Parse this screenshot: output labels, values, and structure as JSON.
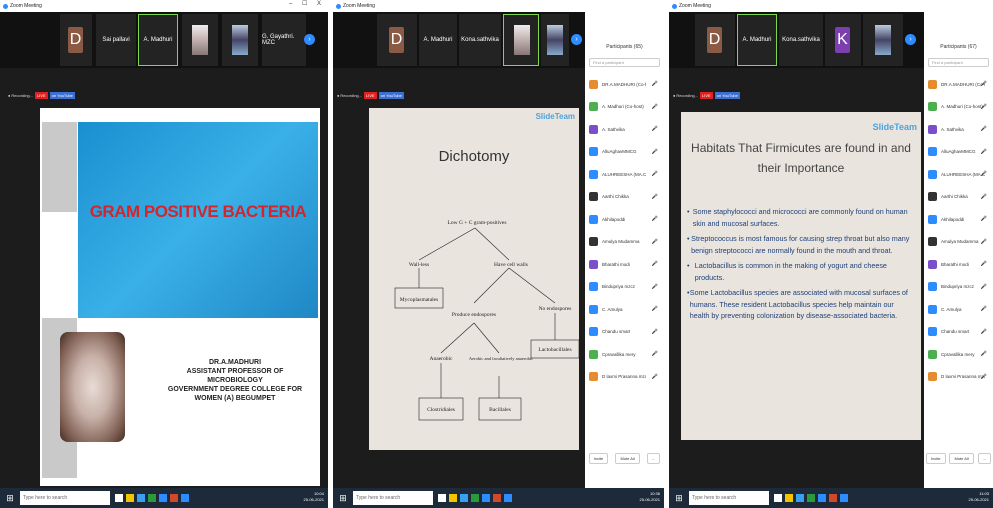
{
  "panel1": {
    "window_title": "Zoom Meeting",
    "window_controls": "– ☐ X",
    "tiles": [
      {
        "kind": "letter",
        "letter": "D",
        "name": "",
        "color": "#8a5a44"
      },
      {
        "kind": "name",
        "name": "Sai pallavi"
      },
      {
        "kind": "name",
        "name": "A. Madhuri"
      },
      {
        "kind": "photo",
        "name": ""
      },
      {
        "kind": "photo",
        "name": ""
      },
      {
        "kind": "name",
        "name": "G. Gayathri. MZC"
      }
    ],
    "recording": "Recording...",
    "live_label": "LIVE",
    "youtube_label": "on YouTube",
    "slide": {
      "title": "GRAM POSITIVE BACTERIA",
      "author_lines": [
        "DR.A.MADHURI",
        "ASSISTANT PROFESSOR OF MICROBIOLOGY",
        "GOVERNMENT DEGREE COLLEGE FOR",
        "WOMEN (A) BEGUMPET"
      ]
    },
    "search_placeholder": "Type here to search",
    "tray_time": "10:04",
    "tray_date": "25-06-2021"
  },
  "panel2": {
    "window_title": "Zoom Meeting",
    "tiles": [
      {
        "kind": "letter",
        "letter": "D",
        "name": "",
        "color": "#8a5a44"
      },
      {
        "kind": "name",
        "name": "A. Madhuri"
      },
      {
        "kind": "name",
        "name": "Kona.sathvika"
      },
      {
        "kind": "photo",
        "name": ""
      },
      {
        "kind": "photo",
        "name": ""
      }
    ],
    "recording": "Recording...",
    "live_label": "LIVE",
    "youtube_label": "on YouTube",
    "slide": {
      "watermark": "SlideTeam",
      "title": "Dichotomy",
      "root": "Low G + C gram-positives",
      "wall_less": "Wall-less",
      "have_walls": "Have cell walls",
      "myco": "Mycoplasmatales",
      "produce": "Produce endospores",
      "no_endo": "No endospores",
      "anaerobic": "Anaerobic",
      "aerobic": "Aerobic and facultatively anaerobic",
      "lacto": "Lactobacillales",
      "clostridiales": "Clostridiales",
      "bacillales": "Bacillales"
    },
    "participants_title": "Participants (65)",
    "participants_search": "Find a participant",
    "participants": [
      {
        "name": "DR.A.MADHURI (Co-host)",
        "color": "#e58c2e"
      },
      {
        "name": "A. Madhuri (Co-host)",
        "color": "#4caf50"
      },
      {
        "name": "A. Sathvika",
        "color": "#7b4fc9"
      },
      {
        "name": "AlluAghavMMCG",
        "color": "#2d8cff"
      },
      {
        "name": "ALUHREESHA (MA.Com)",
        "color": "#2d8cff"
      },
      {
        "name": "Aarthi Chikka",
        "color": "#333"
      },
      {
        "name": "Akhilapoddi",
        "color": "#2d8cff"
      },
      {
        "name": "Amulya Mudamma",
        "color": "#333"
      },
      {
        "name": "Bharathi modi",
        "color": "#7b4fc9"
      },
      {
        "name": "Bindupriya mzcz",
        "color": "#2d8cff"
      },
      {
        "name": "C. Amulya",
        "color": "#2d8cff"
      },
      {
        "name": "Chandu smart",
        "color": "#2d8cff"
      },
      {
        "name": "Cpravallika mery",
        "color": "#4caf50"
      },
      {
        "name": "D laxmi Prasanna mzc",
        "color": "#e58c2e"
      }
    ],
    "invite": "Invite",
    "mute_all": "Mute All",
    "more": "...",
    "search_placeholder": "Type here to search",
    "tray_time": "10:36",
    "tray_date": "25-06-2021"
  },
  "panel3": {
    "window_title": "Zoom Meeting",
    "tiles": [
      {
        "kind": "letter",
        "letter": "D",
        "name": "",
        "color": "#8a5a44"
      },
      {
        "kind": "name",
        "name": "A. Madhuri"
      },
      {
        "kind": "name",
        "name": "Kona.sathvika"
      },
      {
        "kind": "letter",
        "letter": "K",
        "name": "",
        "color": "#7b3fb0"
      },
      {
        "kind": "photo",
        "name": ""
      }
    ],
    "recording": "Recording...",
    "live_label": "LIVE",
    "youtube_label": "on YouTube",
    "slide": {
      "watermark": "SlideTeam",
      "title_line1": "Habitats That Firmicutes are found in and",
      "title_line2": "their Importance",
      "bullets": [
        "Some staphylococci and micrococci are commonly found on human skin and mucosal surfaces.",
        "Streptococcus is most famous for causing strep throat but also many benign streptococci are normally found in the mouth and throat.",
        "Lactobacillus is common in the making of yogurt and cheese products.",
        "Some Lactobacillus species are associated with mucosal surfaces of humans. These resident Lactobacillus species help maintain our health by preventing colonization by disease-associated bacteria."
      ]
    },
    "participants_title": "Participants (67)",
    "participants_search": "Find a participant",
    "participants": [
      {
        "name": "DR.A.MADHURI (Co-host)",
        "color": "#e58c2e"
      },
      {
        "name": "A. Madhuri (Co-host)",
        "color": "#4caf50"
      },
      {
        "name": "A. Sathvika",
        "color": "#7b4fc9"
      },
      {
        "name": "AlluAghavMMCG",
        "color": "#2d8cff"
      },
      {
        "name": "ALUHREESHA (MA.Com)",
        "color": "#2d8cff"
      },
      {
        "name": "Aarthi Chikka",
        "color": "#333"
      },
      {
        "name": "Akhilapoddi",
        "color": "#2d8cff"
      },
      {
        "name": "Amulya Mudamma",
        "color": "#333"
      },
      {
        "name": "Bharathi modi",
        "color": "#7b4fc9"
      },
      {
        "name": "Bindupriya mzcz",
        "color": "#2d8cff"
      },
      {
        "name": "C. Amulya",
        "color": "#2d8cff"
      },
      {
        "name": "Chandu smart",
        "color": "#2d8cff"
      },
      {
        "name": "Cpravallika mery",
        "color": "#4caf50"
      },
      {
        "name": "D laxmi Prasanna mzc",
        "color": "#e58c2e"
      }
    ],
    "invite": "Invite",
    "mute_all": "Mute All",
    "more": "...",
    "search_placeholder": "Type here to search",
    "tray_time": "11:03",
    "tray_date": "25-06-2021"
  }
}
